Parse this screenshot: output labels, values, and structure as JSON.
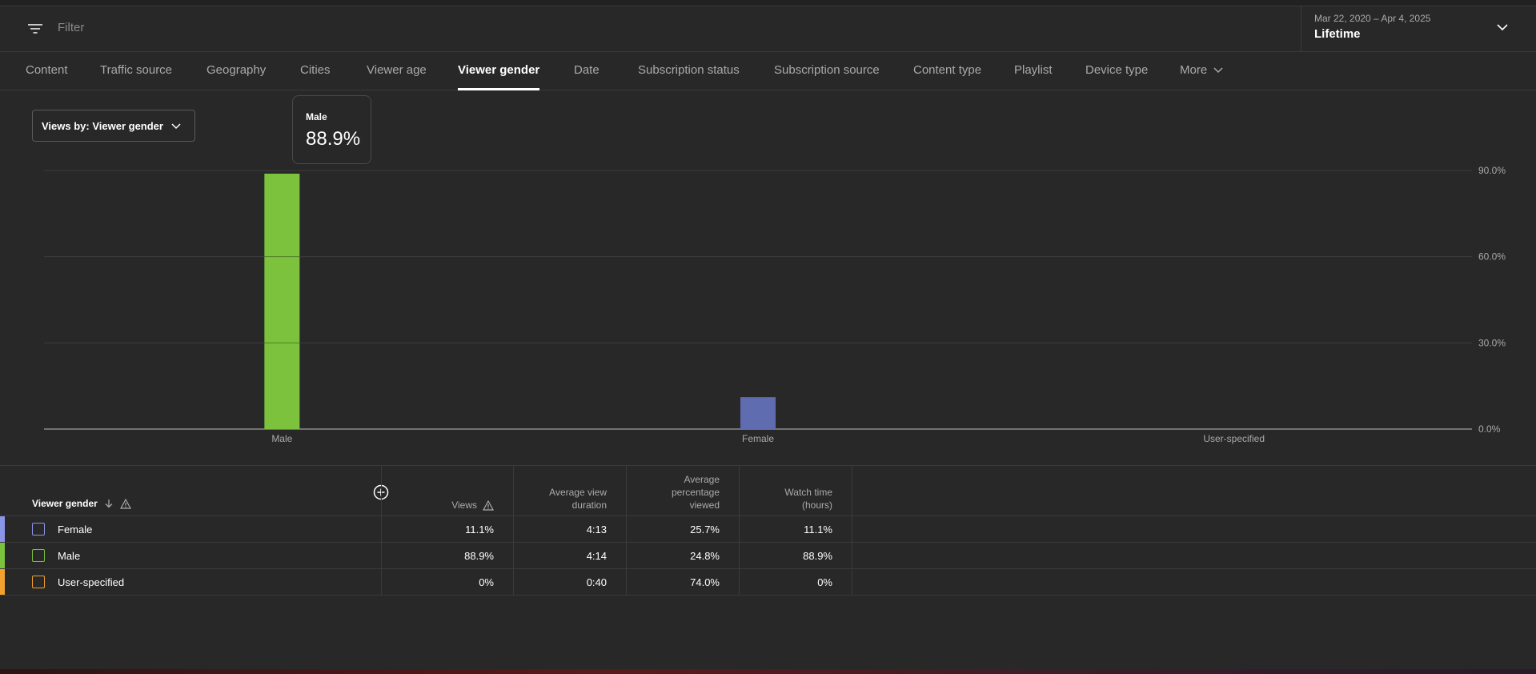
{
  "filter": {
    "placeholder": "Filter",
    "icon": "filter-icon"
  },
  "date_range": {
    "range": "Mar 22, 2020 – Apr 4, 2025",
    "period": "Lifetime",
    "icon": "chevron-down-icon"
  },
  "tabs": [
    {
      "label": "Content"
    },
    {
      "label": "Traffic source"
    },
    {
      "label": "Geography"
    },
    {
      "label": "Cities"
    },
    {
      "label": "Viewer age"
    },
    {
      "label": "Viewer gender",
      "active": true
    },
    {
      "label": "Date"
    },
    {
      "label": "Subscription status"
    },
    {
      "label": "Subscription source"
    },
    {
      "label": "Content type"
    },
    {
      "label": "Playlist"
    },
    {
      "label": "Device type"
    },
    {
      "label": "More",
      "icon": "chevron-down-icon"
    }
  ],
  "views_by": {
    "label": "Views by: Viewer gender"
  },
  "tooltip": {
    "label": "Male",
    "value": "88.9%"
  },
  "chart_data": {
    "type": "bar",
    "categories": [
      "Male",
      "Female",
      "User-specified"
    ],
    "values": [
      88.9,
      11.1,
      0
    ],
    "colors": [
      "#7cc23c",
      "#5f6db0",
      "#f2a12f"
    ],
    "ylim": [
      0,
      90
    ],
    "yticks": [
      "0.0%",
      "30.0%",
      "60.0%",
      "90.0%"
    ],
    "ytick_values": [
      0,
      30,
      60,
      90
    ],
    "grid": true
  },
  "table": {
    "headers": {
      "dimension": "Viewer gender",
      "views": "Views",
      "avg_view_duration": [
        "Average view",
        "duration"
      ],
      "avg_pct_viewed": [
        "Average",
        "percentage",
        "viewed"
      ],
      "watch_time": [
        "Watch time",
        "(hours)"
      ]
    },
    "rows": [
      {
        "name": "Female",
        "color": "#8b95e8",
        "views": "11.1%",
        "avg_view_duration": "4:13",
        "avg_pct_viewed": "25.7%",
        "watch_time": "11.1%"
      },
      {
        "name": "Male",
        "color": "#7cc23c",
        "views": "88.9%",
        "avg_view_duration": "4:14",
        "avg_pct_viewed": "24.8%",
        "watch_time": "88.9%"
      },
      {
        "name": "User-specified",
        "color": "#f2a12f",
        "views": "0%",
        "avg_view_duration": "0:40",
        "avg_pct_viewed": "74.0%",
        "watch_time": "0%"
      }
    ]
  }
}
